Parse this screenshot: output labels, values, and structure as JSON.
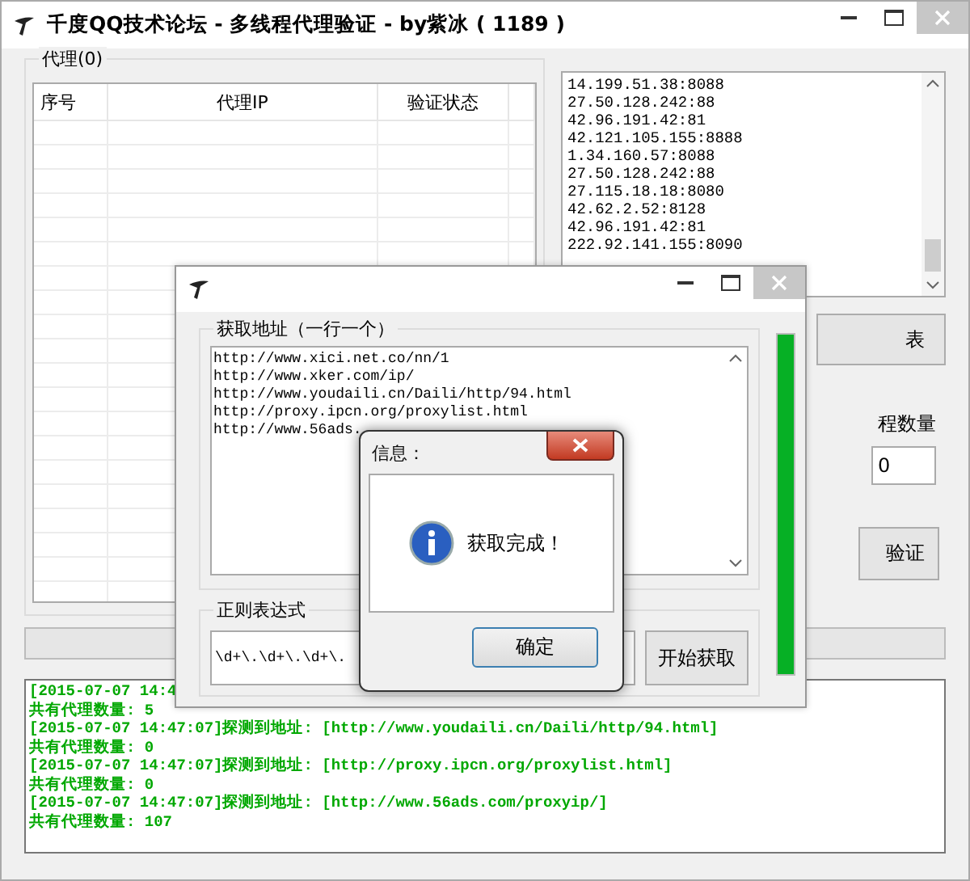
{
  "window": {
    "title": "千度QQ技术论坛 - 多线程代理验证 - by紫冰 ( 1189 )"
  },
  "proxy_group": {
    "label": "代理(0)",
    "columns": [
      "序号",
      "代理IP",
      "验证状态"
    ]
  },
  "ip_list": [
    "14.199.51.38:8088",
    "27.50.128.242:88",
    "42.96.191.42:81",
    "42.121.105.155:8888",
    "1.34.160.57:8088",
    "27.50.128.242:88",
    "27.115.18.18:8080",
    "42.62.2.52:8128",
    "42.96.191.42:81",
    "222.92.141.155:8090"
  ],
  "right_panel": {
    "list_button": "表",
    "thread_count_label": "程数量",
    "thread_count_value": "0",
    "verify_button": "验证"
  },
  "progress": {
    "level": 0
  },
  "log": [
    "[2015-07-07 14:4",
    "共有代理数量: 5",
    "[2015-07-07 14:47:07]探测到地址: [http://www.youdaili.cn/Daili/http/94.html]",
    "共有代理数量: 0",
    "[2015-07-07 14:47:07]探测到地址: [http://proxy.ipcn.org/proxylist.html]",
    "共有代理数量: 0",
    "[2015-07-07 14:47:07]探测到地址: [http://www.56ads.com/proxyip/]",
    "共有代理数量: 107"
  ],
  "fetch_window": {
    "url_label": "获取地址（一行一个）",
    "urls": [
      "http://www.xici.net.co/nn/1",
      "http://www.xker.com/ip/",
      "http://www.youdaili.cn/Daili/http/94.html",
      "http://proxy.ipcn.org/proxylist.html",
      "http://www.56ads."
    ],
    "regex_label": "正则表达式",
    "regex_value": "\\d+\\.\\d+\\.\\d+\\.",
    "start_button": "开始获取",
    "progress": {
      "level": 1
    }
  },
  "message_box": {
    "title": "信息：",
    "message": "获取完成！",
    "ok_button": "确定"
  }
}
